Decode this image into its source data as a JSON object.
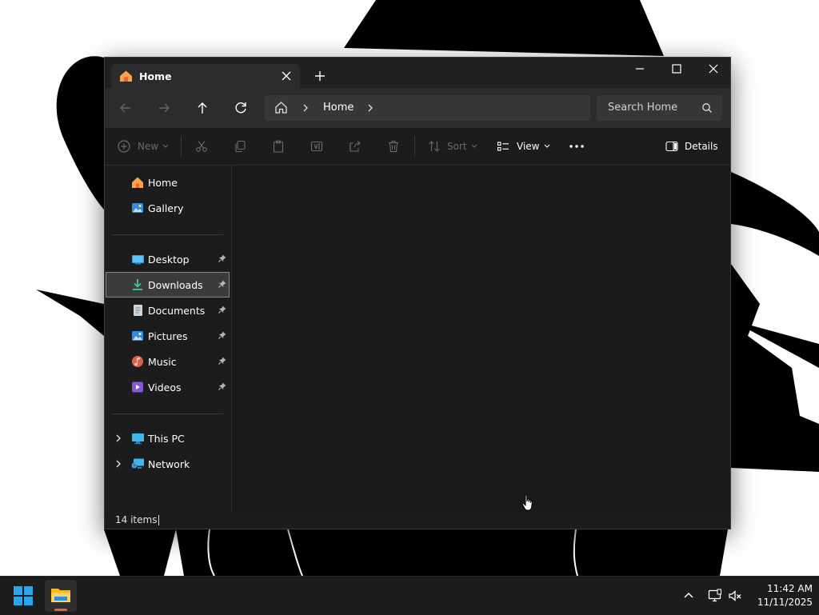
{
  "window": {
    "tab_title": "Home",
    "caption_buttons": [
      "minimize-icon",
      "maximize-icon",
      "close-icon"
    ]
  },
  "navigation": {
    "breadcrumb": [
      "Home"
    ],
    "search_placeholder": "Search Home"
  },
  "command_bar": {
    "new_label": "New",
    "sort_label": "Sort",
    "view_label": "View",
    "details_label": "Details",
    "disabled_actions": [
      "cut-icon",
      "copy-icon",
      "paste-icon",
      "rename-icon",
      "share-icon",
      "delete-icon"
    ]
  },
  "sidebar": {
    "top_items": [
      {
        "label": "Home",
        "icon": "home-icon"
      },
      {
        "label": "Gallery",
        "icon": "gallery-icon"
      }
    ],
    "pinned_items": [
      {
        "label": "Desktop",
        "icon": "desktop-folder-icon"
      },
      {
        "label": "Downloads",
        "icon": "downloads-folder-icon",
        "selected": true
      },
      {
        "label": "Documents",
        "icon": "documents-folder-icon"
      },
      {
        "label": "Pictures",
        "icon": "pictures-folder-icon"
      },
      {
        "label": "Music",
        "icon": "music-folder-icon"
      },
      {
        "label": "Videos",
        "icon": "videos-folder-icon"
      }
    ],
    "drives": [
      {
        "label": "This PC",
        "icon": "this-pc-icon"
      },
      {
        "label": "Network",
        "icon": "network-icon"
      }
    ]
  },
  "status": {
    "item_count": "14 items"
  },
  "taskbar": {
    "time": "11:42 AM",
    "date": "11/11/2025",
    "apps": [
      "start-icon",
      "file-explorer-icon"
    ],
    "tray": [
      "chevron-up-icon",
      "network-icon",
      "volume-muted-icon"
    ]
  },
  "colors": {
    "window_bg": "#191919",
    "navbar_bg": "#2c2c2c",
    "accent_orange": "#e8643c",
    "windows_blue": "#29a4ef"
  }
}
